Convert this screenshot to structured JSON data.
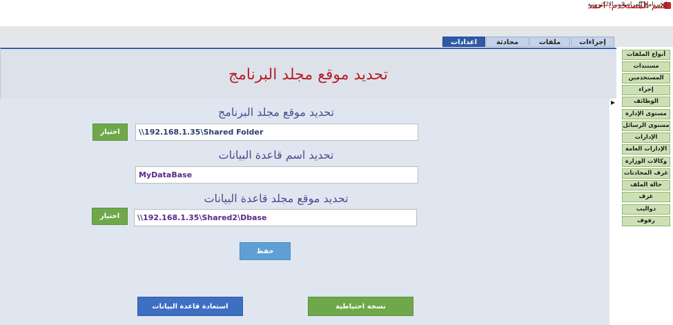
{
  "window": {
    "title": "برنامج المراسلات الالكترونية",
    "min_glyph": "—",
    "max_glyph": "❐",
    "close_glyph": "✕"
  },
  "user": {
    "label": "اسم المستخدم: احمد"
  },
  "tabs": [
    {
      "label": "إجراءات"
    },
    {
      "label": "ملفات"
    },
    {
      "label": "محادثة"
    },
    {
      "label": "اعدادات"
    }
  ],
  "page": {
    "title": "تحديد موقع مجلد البرنامج"
  },
  "program_folder": {
    "label": "تحديد موقع مجلد البرنامج",
    "value": "\\\\192.168.1.35\\Shared Folder",
    "choose_label": "اختيار"
  },
  "database_name": {
    "label": "تحديد اسم قاعدة البيانات",
    "value": "MyDataBase"
  },
  "database_folder": {
    "label": "تحديد موقع مجلد قاعدة البيانات",
    "value": "\\\\192.168.1.35\\Shared2\\Dbase",
    "choose_label": "اختيار"
  },
  "actions": {
    "save_label": "حفظ",
    "restore_label": "استعادة قاعدة البيانات",
    "backup_label": "نسخة احتياطية"
  },
  "sidebar": {
    "items": [
      {
        "label": "أنواع الملفات"
      },
      {
        "label": "مستندات"
      },
      {
        "label": "المستخدمين"
      },
      {
        "label": "إجراء"
      },
      {
        "label": "الوظائف"
      },
      {
        "label": "مستوى الإدارة"
      },
      {
        "label": "مستوى الرسائل"
      },
      {
        "label": "الإدارات"
      },
      {
        "label": "الإدارات العامة"
      },
      {
        "label": "وكالات الوزارة"
      },
      {
        "label": "غرف المحادثات"
      },
      {
        "label": "حالة الملف"
      },
      {
        "label": "غرف"
      },
      {
        "label": "دواليب"
      },
      {
        "label": "رفوف"
      }
    ]
  }
}
